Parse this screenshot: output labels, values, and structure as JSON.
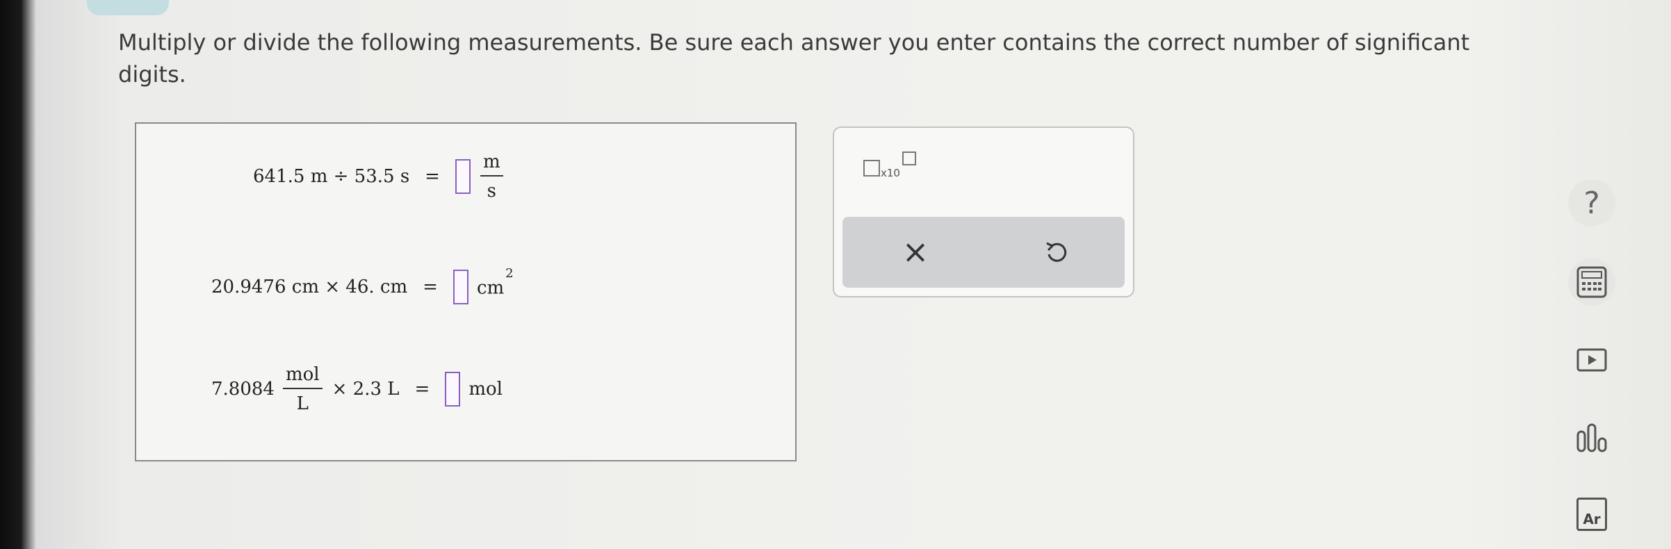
{
  "instructions": "Multiply or divide the following measurements. Be sure each answer you enter contains the correct number of significant digits.",
  "problems": [
    {
      "left": "641.5 m ÷ 53.5 s",
      "equals": "=",
      "unit_num": "m",
      "unit_den": "s"
    },
    {
      "left": "20.9476 cm × 46. cm",
      "equals": "=",
      "unit": "cm",
      "unit_exp": "2"
    },
    {
      "coef": "7.8084",
      "frac_num": "mol",
      "frac_den": "L",
      "rest": "× 2.3 L",
      "equals": "=",
      "unit": "mol"
    }
  ],
  "toolbar": {
    "sci_notation_text": "x10",
    "clear_symbol": "×"
  },
  "sidebar": {
    "help_symbol": "?",
    "periodic_text": "Ar"
  },
  "colors": {
    "answer_box_border": "#8b5fbf",
    "accent_teal": "#c4dde0"
  }
}
